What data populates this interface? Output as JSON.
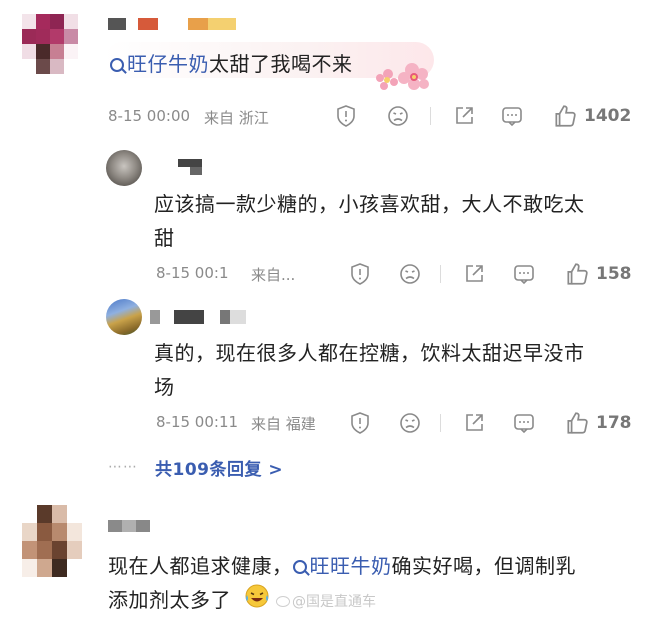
{
  "comment1": {
    "topic": "旺仔牛奶",
    "text": "太甜了我喝不来",
    "time": "8-15 00:00",
    "location": "来自 浙江",
    "likes": "1402"
  },
  "reply1": {
    "text_line1": "应该搞一款少糖的，小孩喜欢甜，大人不敢吃太",
    "text_line2": "甜",
    "time": "8-15 00:1",
    "location": "来自...",
    "likes": "158"
  },
  "reply2": {
    "text_line1": "真的，现在很多人都在控糖，饮料太甜迟早没市",
    "text_line2": "场",
    "time": "8-15 00:11",
    "location": "来自 福建",
    "likes": "178"
  },
  "replies_footer": {
    "dots": "⋯⋯",
    "label": "共109条回复 >"
  },
  "comment2": {
    "prefix": "现在人都追求健康，",
    "topic": "旺旺牛奶",
    "suffix": "确实好喝，但调制乳",
    "text_line2": "添加剂太多了",
    "watermark": "@国是直通车"
  },
  "icons": [
    "report-icon",
    "dislike-icon",
    "share-icon",
    "reply-icon",
    "like-icon"
  ],
  "colors": {
    "link": "#3a5db0",
    "meta": "#8a8a8a"
  }
}
